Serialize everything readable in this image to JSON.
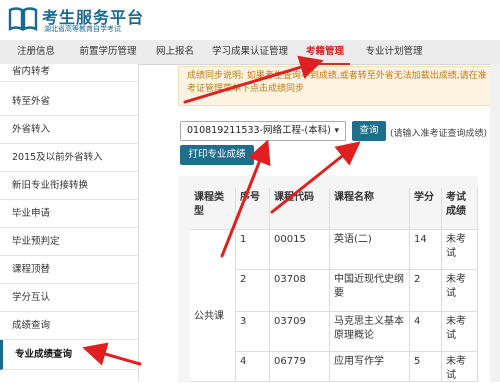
{
  "header": {
    "title": "考生服务平台",
    "subtitle": "湖北省高等教育自学考试",
    "logo_icon": "book-icon"
  },
  "nav": {
    "items": [
      {
        "label": "注册信息"
      },
      {
        "label": "前置学历管理"
      },
      {
        "label": "网上报名"
      },
      {
        "label": "学习成果认证管理"
      },
      {
        "label": "考籍管理",
        "active": true
      },
      {
        "label": "专业计划管理"
      }
    ]
  },
  "sidebar": {
    "items": [
      {
        "label": "省内转考"
      },
      {
        "label": "转至外省"
      },
      {
        "label": "外省转入"
      },
      {
        "label": "2015及以前外省转入"
      },
      {
        "label": "新旧专业衔接转换"
      },
      {
        "label": "毕业申请"
      },
      {
        "label": "毕业预判定"
      },
      {
        "label": "课程顶替"
      },
      {
        "label": "学分互认"
      },
      {
        "label": "成绩查询"
      },
      {
        "label": "专业成绩查询",
        "active": true
      }
    ]
  },
  "notice": {
    "text": "成绩同步说明: 如果考生查询不到成绩,或者转至外省无法加载出成绩,请在准考证管理菜单下点击成绩同步"
  },
  "query": {
    "selected": "010819211533-网络工程-(本科)",
    "query_label": "查询",
    "hint": "(请输入准考证查询成绩)",
    "print_label": "打印专业成绩"
  },
  "table": {
    "headers": [
      "课程类型",
      "序号",
      "课程代码",
      "课程名称",
      "学分",
      "考试成绩"
    ],
    "group_label": "公共课",
    "rows": [
      {
        "no": "1",
        "code": "00015",
        "name": "英语(二)",
        "credit": "14",
        "score": "未考试"
      },
      {
        "no": "2",
        "code": "03708",
        "name": "中国近现代史纲要",
        "credit": "2",
        "score": "未考试"
      },
      {
        "no": "3",
        "code": "03709",
        "name": "马克思主义基本原理概论",
        "credit": "4",
        "score": "未考试"
      },
      {
        "no": "4",
        "code": "06779",
        "name": "应用写作学",
        "credit": "5",
        "score": "未考试"
      }
    ]
  },
  "colors": {
    "brand": "#1a6a8f",
    "button": "#1f6e8c",
    "annotation": "#e02020",
    "notice_text": "#c07a1b"
  }
}
